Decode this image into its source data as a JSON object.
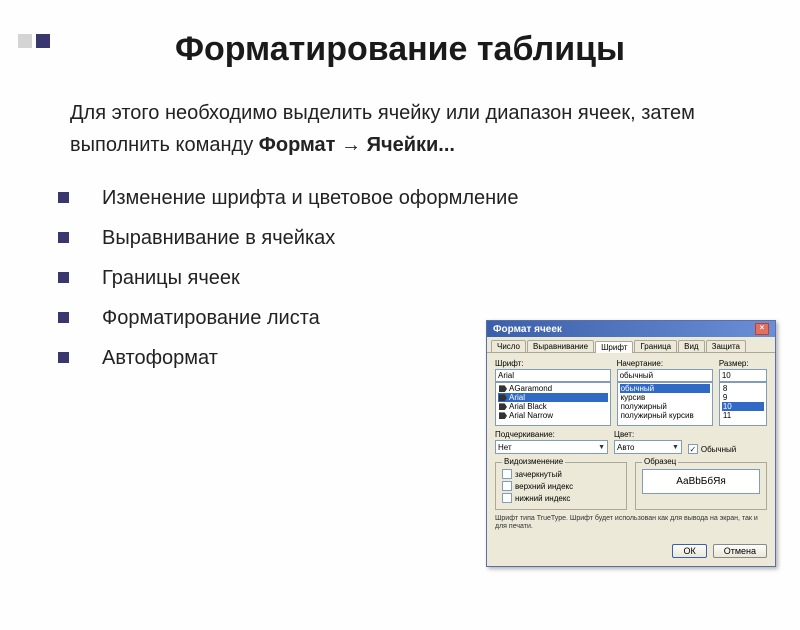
{
  "title": "Форматирование таблицы",
  "intro": {
    "pre": "Для этого необходимо выделить ячейку или диапазон ячеек, затем выполнить команду ",
    "bold": "Формат → Ячейки..."
  },
  "bullets": [
    "Изменение шрифта и цветовое оформление",
    "Выравнивание в ячейках",
    "Границы ячеек",
    "Форматирование листа",
    "Автоформат"
  ],
  "dialog": {
    "title": "Формат ячеек",
    "tabs": [
      "Число",
      "Выравнивание",
      "Шрифт",
      "Граница",
      "Вид",
      "Защита"
    ],
    "activeTab": "Шрифт",
    "fontLabel": "Шрифт:",
    "styleLabel": "Начертание:",
    "sizeLabel": "Размер:",
    "fontValue": "Arial",
    "fontOptions": [
      "AGaramond",
      "Arial",
      "Arial Black",
      "Arial Narrow"
    ],
    "styleValue": "обычный",
    "styleOptions": [
      "обычный",
      "курсив",
      "полужирный",
      "полужирный курсив"
    ],
    "sizeValue": "10",
    "sizeOptions": [
      "8",
      "9",
      "10",
      "11"
    ],
    "underlineLabel": "Подчеркивание:",
    "underlineValue": "Нет",
    "colorLabel": "Цвет:",
    "colorValue": "Авто",
    "normalCheck": "Обычный",
    "effectsGroup": "Видоизменение",
    "effects": [
      "зачеркнутый",
      "верхний индекс",
      "нижний индекс"
    ],
    "previewGroup": "Образец",
    "previewText": "АаВbБбЯя",
    "hint": "Шрифт типа TrueType. Шрифт будет использован как для вывода на экран, так и для печати.",
    "ok": "ОК",
    "cancel": "Отмена"
  }
}
